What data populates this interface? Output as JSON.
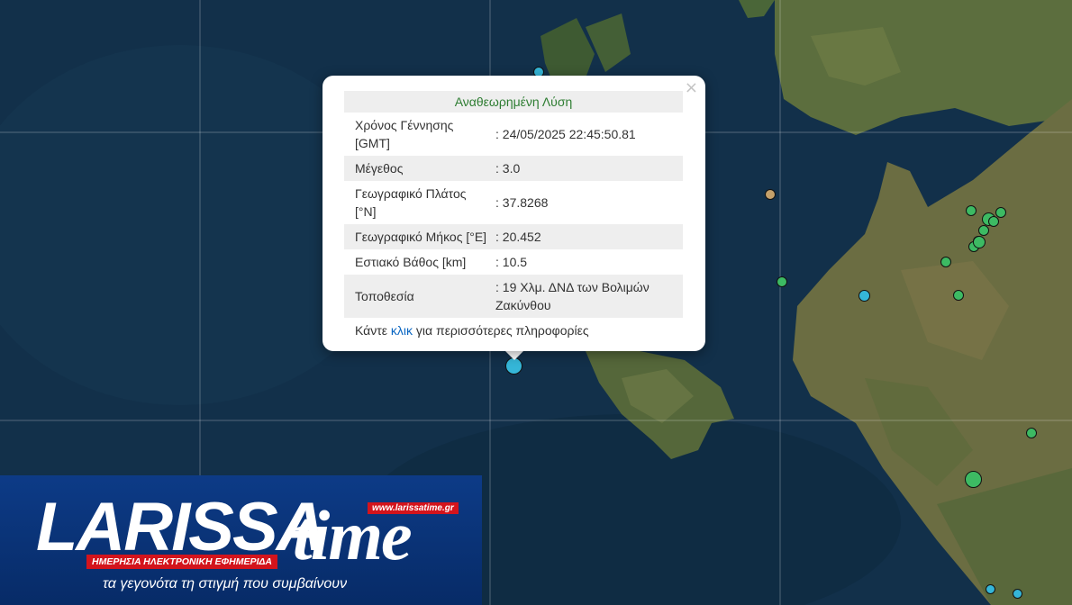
{
  "popup": {
    "title": "Αναθεωρημένη Λύση",
    "rows": [
      {
        "label": "Χρόνος Γέννησης [GMT]",
        "value": ": 24/05/2025 22:45:50.81"
      },
      {
        "label": "Μέγεθος",
        "value": ": 3.0"
      },
      {
        "label": "Γεωγραφικό Πλάτος [°N]",
        "value": ": 37.8268"
      },
      {
        "label": "Γεωγραφικό Μήκος [°E]",
        "value": ": 20.452"
      },
      {
        "label": "Εστιακό Βάθος [km]",
        "value": ": 10.5"
      },
      {
        "label": "Τοποθεσία",
        "value": ": 19 Χλμ. ΔΝΔ των Βολιμών Ζακύνθου"
      }
    ],
    "footer_prefix": "Κάντε ",
    "footer_link": "κλικ",
    "footer_suffix": " για περισσότερες πληροφορίες",
    "close": "×"
  },
  "logo": {
    "word": "LARISSA",
    "time": "time",
    "url": "www.larissatime.gr",
    "subtitle": "ΗΜΕΡΗΣΙΑ ΗΛΕΚΤΡΟΝΙΚΗ ΕΦΗΜΕΡΙΔΑ",
    "tagline": "τα γεγονότα τη στιγμή που συμβαίνουν"
  },
  "markers": {
    "selected_color": "#35b6d8",
    "recent_color": "#3dba63",
    "older_color": "#c4a06a"
  }
}
